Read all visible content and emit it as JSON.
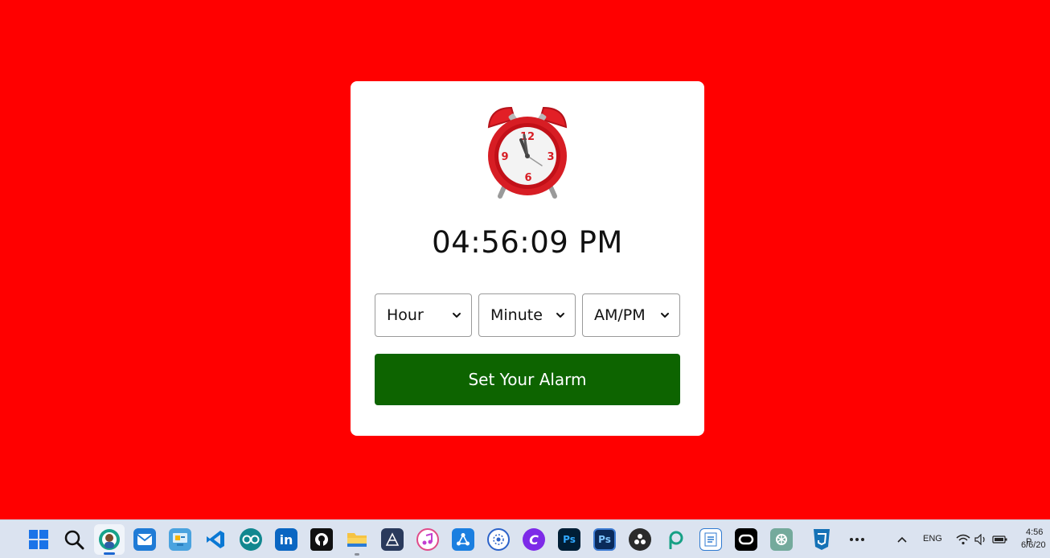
{
  "app": {
    "background_color": "#ff0000",
    "card_color": "#ffffff",
    "alarm_icon": "alarm-clock-icon",
    "current_time": "04:56:09 PM",
    "selects": {
      "hour": {
        "selected": "Hour"
      },
      "minute": {
        "selected": "Minute"
      },
      "ampm": {
        "selected": "AM/PM"
      }
    },
    "set_button": {
      "label": "Set Your Alarm",
      "color": "#0d6400"
    }
  },
  "clock_face": {
    "numerals": [
      "12",
      "3",
      "6",
      "9"
    ]
  },
  "taskbar": {
    "icons": [
      "windows-start-icon",
      "search-icon",
      "edge-browser-icon",
      "mail-icon",
      "control-panel-icon",
      "vscode-icon",
      "arduino-icon",
      "linkedin-icon",
      "github-icon",
      "file-explorer-icon",
      "vectorizer-icon",
      "itunes-icon",
      "share-icon",
      "settings-badge-icon",
      "canva-icon",
      "photoshop-icon",
      "photoshop-classic-icon",
      "obs-icon",
      "picsart-icon",
      "notepad-icon",
      "capcut-icon",
      "chatgpt-icon",
      "css3-icon",
      "more-icon"
    ],
    "tray": {
      "chevron_icon": "chevron-up-icon",
      "language": "ENG",
      "wifi_icon": "wifi-icon",
      "volume_icon": "volume-icon",
      "battery_icon": "battery-icon",
      "time": "4:56 P",
      "date": "6/6/20"
    }
  }
}
